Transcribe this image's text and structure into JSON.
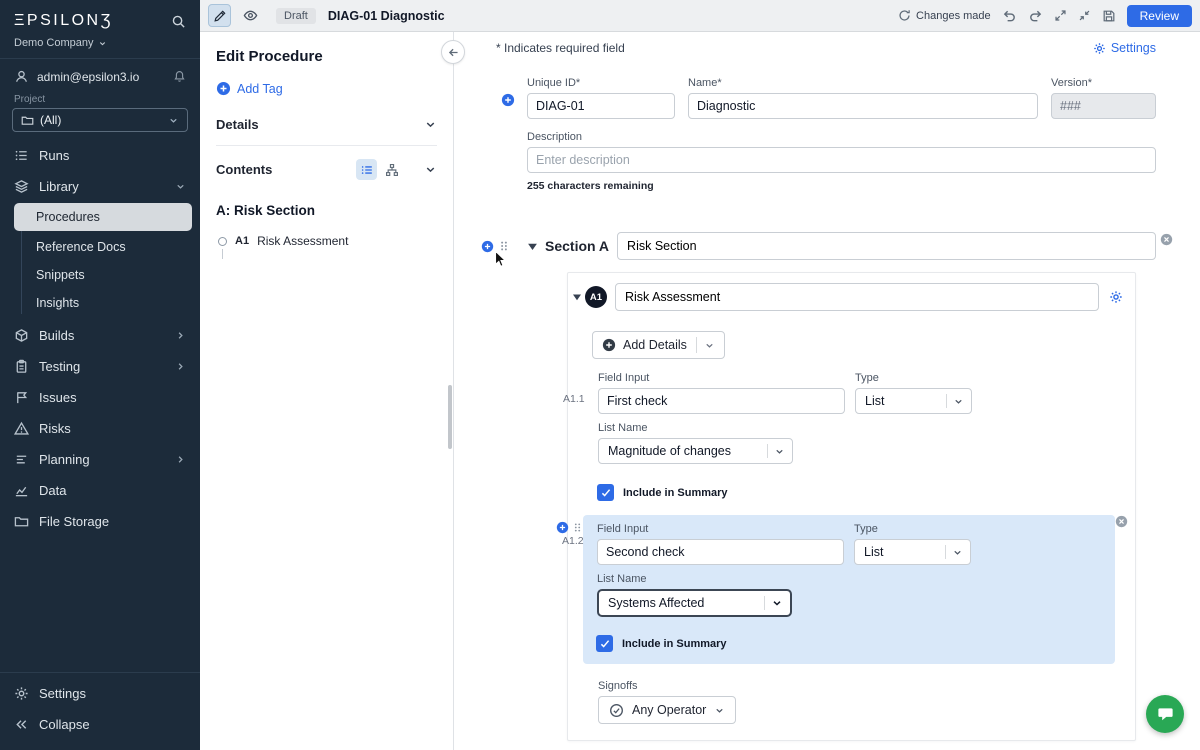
{
  "colors": {
    "accent": "#2e6be6",
    "sidebar_bg": "#1c2b3a",
    "highlight": "#d9e8f9",
    "chat_green": "#29a855"
  },
  "sidebar": {
    "logo": "ΞPSILONƷ",
    "company": "Demo Company",
    "email": "admin@epsilon3.io",
    "project_label": "Project",
    "project_value": "(All)",
    "nav": [
      {
        "label": "Runs"
      },
      {
        "label": "Library"
      },
      {
        "label": "Procedures"
      },
      {
        "label": "Reference Docs"
      },
      {
        "label": "Snippets"
      },
      {
        "label": "Insights"
      },
      {
        "label": "Builds"
      },
      {
        "label": "Testing"
      },
      {
        "label": "Issues"
      },
      {
        "label": "Risks"
      },
      {
        "label": "Planning"
      },
      {
        "label": "Data"
      },
      {
        "label": "File Storage"
      }
    ],
    "settings": "Settings",
    "collapse": "Collapse"
  },
  "topbar": {
    "draft": "Draft",
    "title": "DIAG-01 Diagnostic",
    "changes": "Changes made",
    "review": "Review"
  },
  "panel": {
    "title": "Edit Procedure",
    "add_tag": "Add Tag",
    "details": "Details",
    "contents": "Contents",
    "tree_heading": "A: Risk Section",
    "tree_item_id": "A1",
    "tree_item_label": "Risk Assessment"
  },
  "main": {
    "required_note": "* Indicates required field",
    "settings": "Settings",
    "unique_id_label": "Unique ID*",
    "unique_id": "DIAG-01",
    "name_label": "Name*",
    "name": "Diagnostic",
    "version_label": "Version*",
    "version": "###",
    "description_label": "Description",
    "description_placeholder": "Enter description",
    "chars_remaining": "255 characters remaining",
    "section": {
      "label": "Section A",
      "name": "Risk Section",
      "step_id": "A1",
      "step_name": "Risk Assessment",
      "add_details": "Add Details",
      "fields": [
        {
          "id": "A1.1",
          "field_input_label": "Field Input",
          "value": "First check",
          "type_label": "Type",
          "type": "List",
          "list_name_label": "List Name",
          "list_name": "Magnitude of changes",
          "include": "Include in Summary"
        },
        {
          "id": "A1.2",
          "field_input_label": "Field Input",
          "value": "Second check",
          "type_label": "Type",
          "type": "List",
          "list_name_label": "List Name",
          "list_name": "Systems Affected",
          "include": "Include in Summary"
        }
      ],
      "signoffs_label": "Signoffs",
      "signoffs": "Any Operator"
    }
  }
}
